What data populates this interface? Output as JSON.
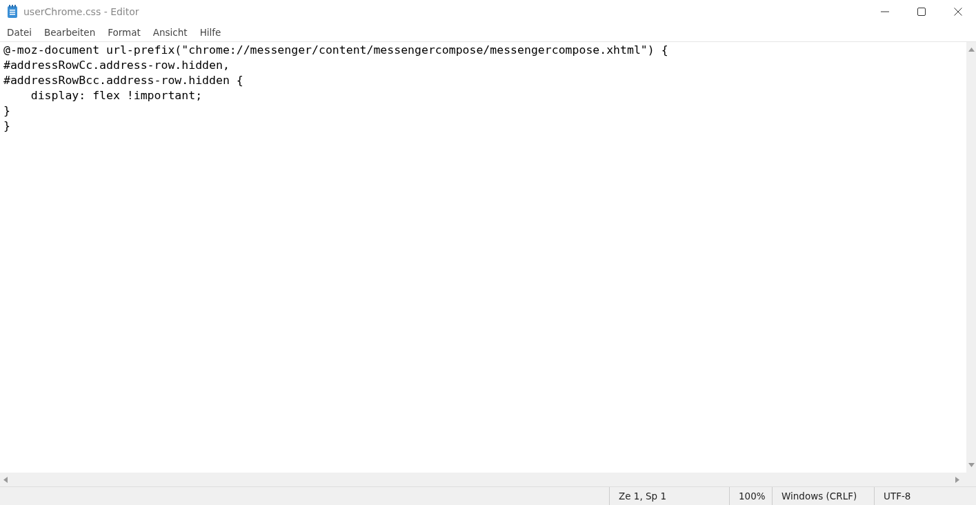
{
  "window": {
    "title": "userChrome.css - Editor"
  },
  "menu": [
    "Datei",
    "Bearbeiten",
    "Format",
    "Ansicht",
    "Hilfe"
  ],
  "editor": {
    "lines": [
      "@-moz-document url-prefix(\"chrome://messenger/content/messengercompose/messengercompose.xhtml\") {",
      "#addressRowCc.address-row.hidden,",
      "#addressRowBcc.address-row.hidden {",
      "    display: flex !important;",
      "}",
      "}"
    ]
  },
  "status_bar": [
    "Ze 1, Sp 1",
    "100%",
    "Windows (CRLF)",
    "UTF-8"
  ]
}
